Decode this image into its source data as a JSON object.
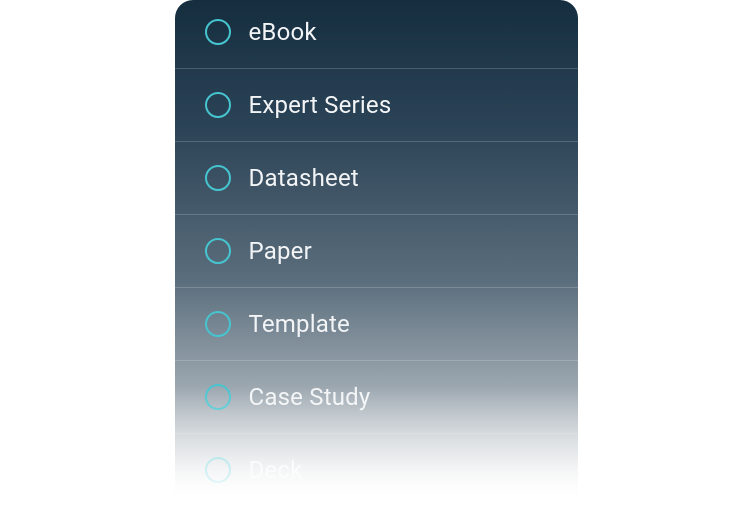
{
  "filter": {
    "options": [
      {
        "label": "eBook"
      },
      {
        "label": "Expert Series"
      },
      {
        "label": "Datasheet"
      },
      {
        "label": "Paper"
      },
      {
        "label": "Template"
      },
      {
        "label": "Case Study"
      },
      {
        "label": "Deck"
      }
    ]
  },
  "colors": {
    "radio_ring": "#46c4cf",
    "panel_top": "#152e3f",
    "panel_bottom": "#ffffff",
    "text": "#f2f4f6"
  }
}
